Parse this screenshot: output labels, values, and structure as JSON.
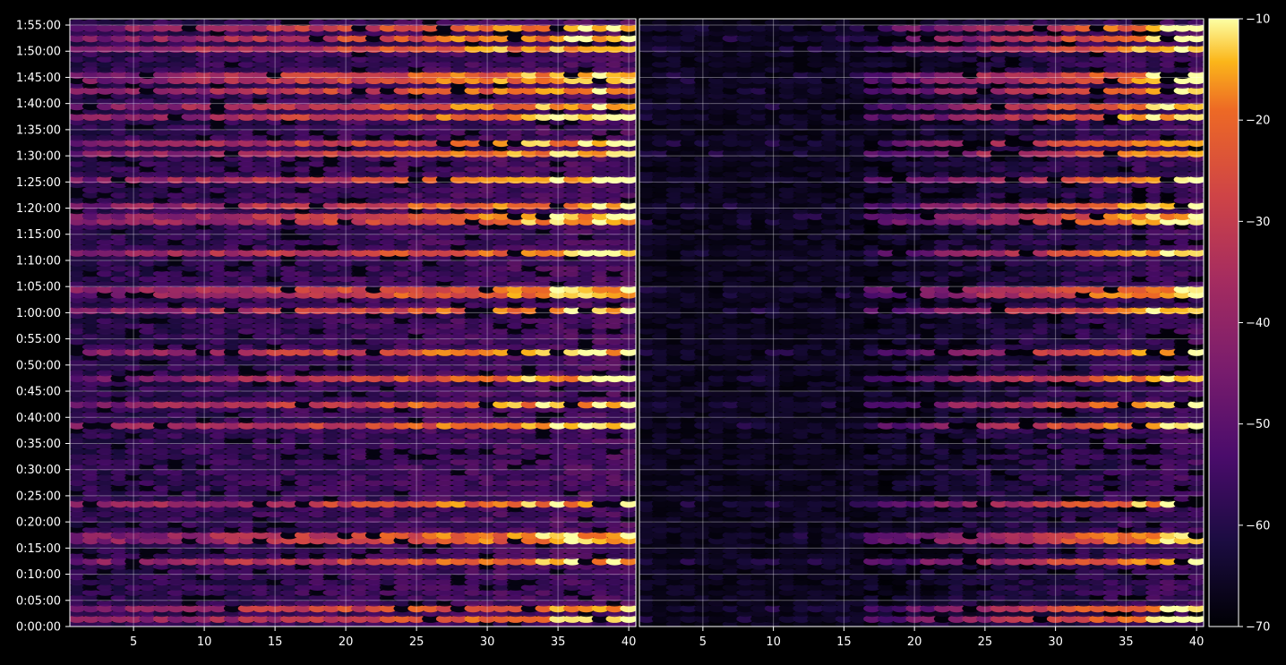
{
  "chart_data": {
    "type": "heatmap",
    "title": "",
    "xlabel": "",
    "ylabel": "",
    "panels": [
      {
        "name": "",
        "x_range": [
          1,
          40
        ]
      },
      {
        "name": "",
        "x_range": [
          1,
          40
        ]
      }
    ],
    "x_ticks": [
      "5",
      "10",
      "15",
      "20",
      "25",
      "30",
      "35",
      "40"
    ],
    "x_tick_values": [
      5,
      10,
      15,
      20,
      25,
      30,
      35,
      40
    ],
    "y_ticks": [
      "0:00:00",
      "0:05:00",
      "0:10:00",
      "0:15:00",
      "0:20:00",
      "0:25:00",
      "0:30:00",
      "0:35:00",
      "0:40:00",
      "0:45:00",
      "0:50:00",
      "0:55:00",
      "1:00:00",
      "1:05:00",
      "1:10:00",
      "1:15:00",
      "1:20:00",
      "1:25:00",
      "1:30:00",
      "1:35:00",
      "1:40:00",
      "1:45:00",
      "1:50:00",
      "1:55:00"
    ],
    "y_range_minutes": [
      0,
      115
    ],
    "grid": true,
    "colormap": "inferno",
    "colorbar": {
      "ticks": [
        "−10",
        "−20",
        "−30",
        "−40",
        "−50",
        "−60",
        "−70"
      ],
      "tick_values": [
        -10,
        -20,
        -30,
        -40,
        -50,
        -60,
        -70
      ],
      "vmin": -70,
      "vmax": -10
    },
    "bright_bands_minutes": [
      1,
      3,
      12,
      16,
      17,
      23,
      38,
      42,
      47,
      52,
      60,
      63,
      64,
      71,
      77,
      78,
      80,
      85,
      90,
      92,
      97,
      99,
      102,
      104,
      105,
      110,
      112,
      114
    ],
    "left_panel_description_values": {
      "background_level": -58,
      "band_peak_level": -18
    },
    "right_panel_active_x_from": 17
  }
}
